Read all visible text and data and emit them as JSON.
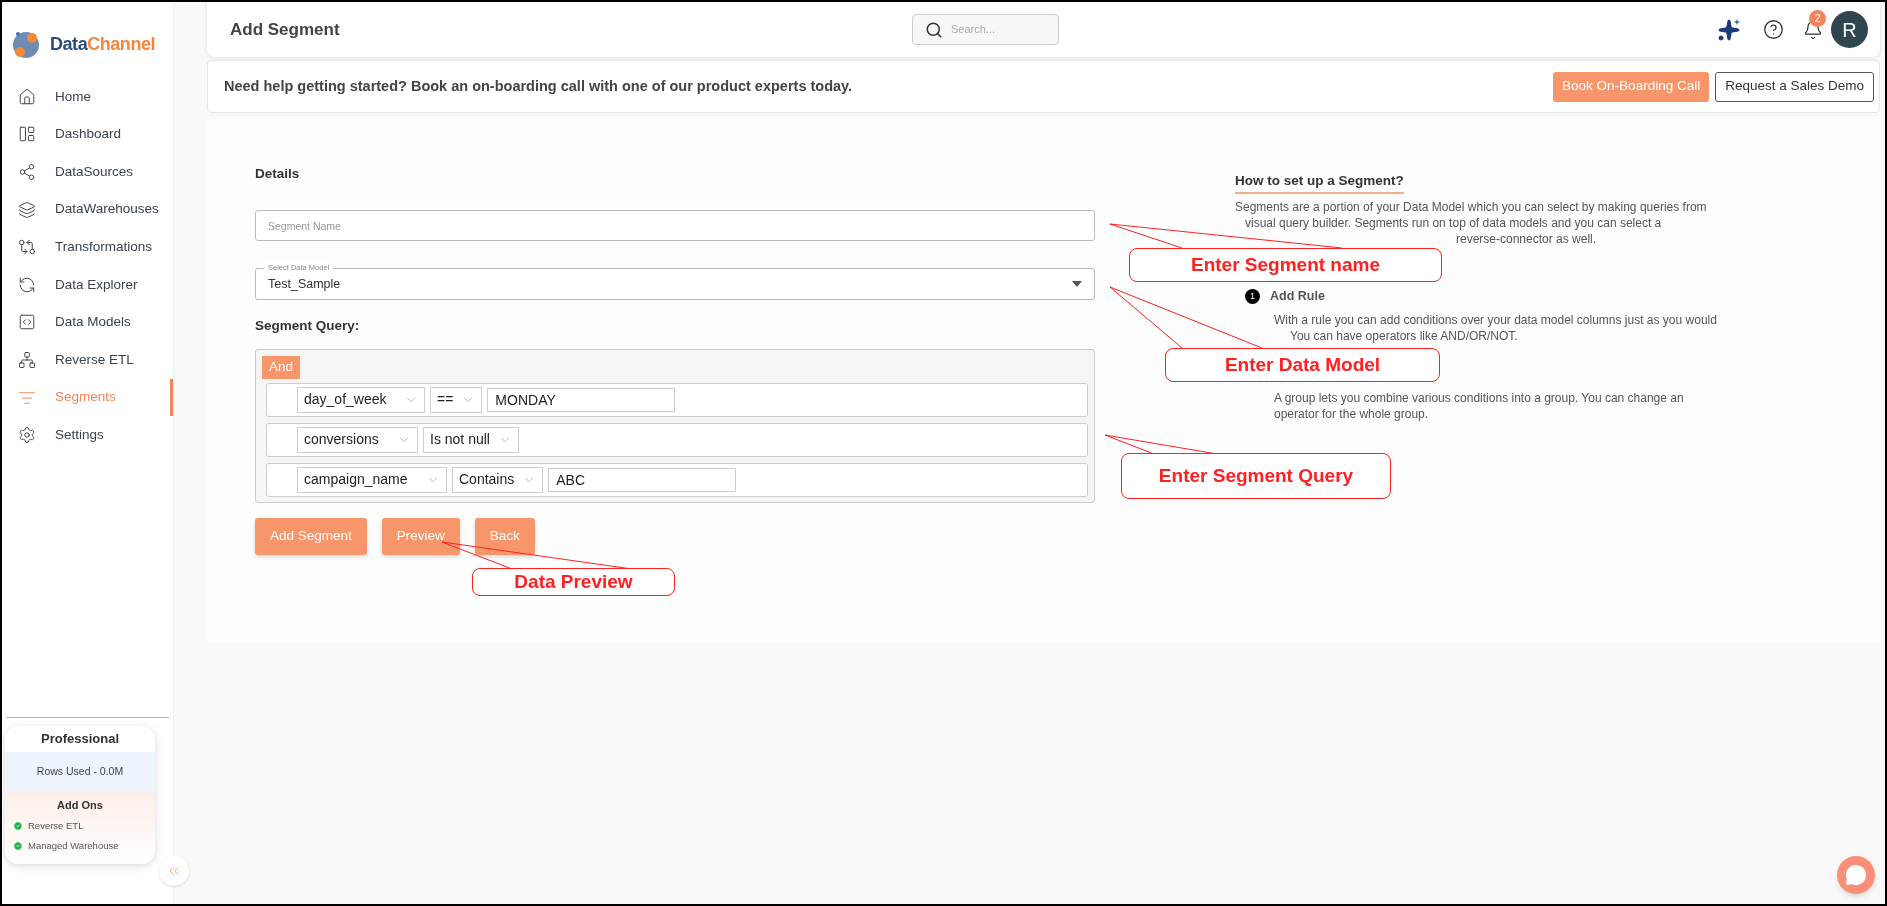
{
  "brand": {
    "part_1": "Data",
    "part_2": "Channel"
  },
  "sidebar": {
    "items": [
      {
        "label": "Home",
        "selected": false
      },
      {
        "label": "Dashboard",
        "selected": false
      },
      {
        "label": "DataSources",
        "selected": false
      },
      {
        "label": "DataWarehouses",
        "selected": false
      },
      {
        "label": "Transformations",
        "selected": false
      },
      {
        "label": "Data Explorer",
        "selected": false
      },
      {
        "label": "Data Models",
        "selected": false
      },
      {
        "label": "Reverse ETL",
        "selected": false
      },
      {
        "label": "Segments",
        "selected": true
      },
      {
        "label": "Settings",
        "selected": false
      }
    ],
    "plan": {
      "title": "Professional",
      "usage": "Rows Used - 0.0M",
      "addons_title": "Add Ons",
      "addons": [
        {
          "label": "Reverse ETL",
          "enabled": true
        },
        {
          "label": "Managed Warehouse",
          "enabled": true
        }
      ]
    }
  },
  "header": {
    "title": "Add Segment",
    "search": {
      "placeholder": "Search..."
    },
    "notifications": "2",
    "avatar": "R"
  },
  "banner": {
    "text": "Need help getting started? Book an on-boarding call with one of our product experts today.",
    "buttons": [
      {
        "label": "Book On-Boarding Call",
        "kind": "primary"
      },
      {
        "label": "Request a Sales Demo",
        "kind": "outline"
      }
    ]
  },
  "form": {
    "section": "Details",
    "segment_name": {
      "placeholder": "Segment Name"
    },
    "data_model": {
      "label": "Select Data Model",
      "value": "Test_Sample"
    },
    "query_label": "Segment Query:",
    "combinator": "And",
    "rules": [
      {
        "field": "day_of_week",
        "operator": "==",
        "value": "MONDAY"
      },
      {
        "field": "conversions",
        "operator": "Is not null"
      },
      {
        "field": "campaign_name",
        "operator": "Contains",
        "value": "ABC"
      }
    ],
    "buttons": [
      "Add Segment",
      "Preview",
      "Back"
    ]
  },
  "help": {
    "title": "How to set up a Segment?",
    "intro_lines": [
      "Segments are a portion of your Data Model which you can select by making queries from",
      "visual query builder. Segments run on top of data models and you can select a",
      "reverse-connector as well."
    ],
    "steps": [
      {
        "number": "1",
        "title": "Add Rule",
        "lines": [
          "With a rule you can add conditions over your data model columns just as you would",
          "You can have operators like AND/OR/NOT."
        ]
      },
      {
        "lines": [
          "A group lets you combine various conditions into a group. You can change an",
          "operator for the whole group."
        ]
      }
    ]
  },
  "annotations": [
    {
      "text": "Enter Segment name"
    },
    {
      "text": "Enter Data Model"
    },
    {
      "text": "Enter Segment Query"
    },
    {
      "text": "Data Preview"
    }
  ]
}
